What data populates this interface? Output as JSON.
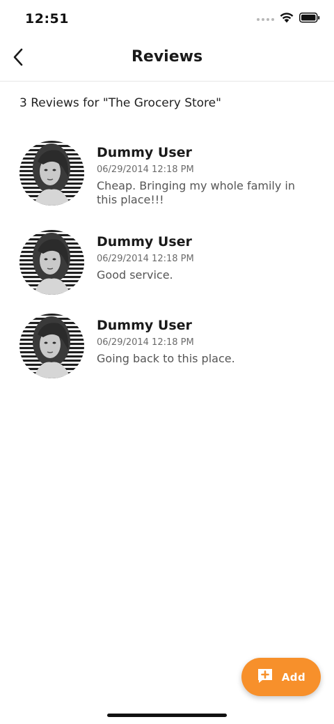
{
  "status_bar": {
    "time": "12:51"
  },
  "header": {
    "title": "Reviews",
    "back_icon": "chevron-left-icon"
  },
  "summary": {
    "text": "3 Reviews for \"The Grocery Store\""
  },
  "reviews": [
    {
      "name": "Dummy User",
      "date": "06/29/2014 12:18 PM",
      "body": "Cheap. Bringing my whole family in this place!!!"
    },
    {
      "name": "Dummy User",
      "date": "06/29/2014 12:18 PM",
      "body": "Good service."
    },
    {
      "name": "Dummy User",
      "date": "06/29/2014 12:18 PM",
      "body": "Going back to this place."
    }
  ],
  "fab": {
    "label": "Add",
    "icon": "add-comment-icon",
    "color": "#f7902b"
  }
}
